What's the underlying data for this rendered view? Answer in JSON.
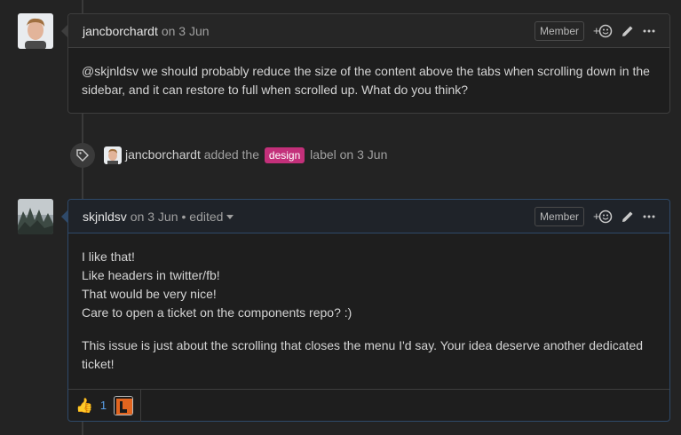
{
  "comment1": {
    "author": "jancborchardt",
    "meta": "on 3 Jun",
    "badge": "Member",
    "body": "@skjnldsv we should probably reduce the size of the content above the tabs when scrolling down in the sidebar, and it can restore to full when scrolled up. What do you think?"
  },
  "event": {
    "actor": "jancborchardt",
    "text_before": "added the",
    "label": "design",
    "text_after": "label on 3 Jun",
    "label_color": "#c3307a"
  },
  "comment2": {
    "author": "skjnldsv",
    "meta": "on 3 Jun",
    "edited": "• edited",
    "badge": "Member",
    "lines": [
      "I like that!",
      "Like headers in twitter/fb!",
      "That would be very nice!",
      "Care to open a ticket on the components repo? :)"
    ],
    "para2": "This issue is just about the scrolling that closes the menu I'd say. Your idea deserve another dedicated ticket!",
    "reaction": {
      "emoji": "👍",
      "count": "1"
    }
  },
  "icons": {
    "add_reaction": "+😊",
    "edit": "pencil-icon",
    "more": "kebab-icon",
    "tag": "tag-icon"
  }
}
